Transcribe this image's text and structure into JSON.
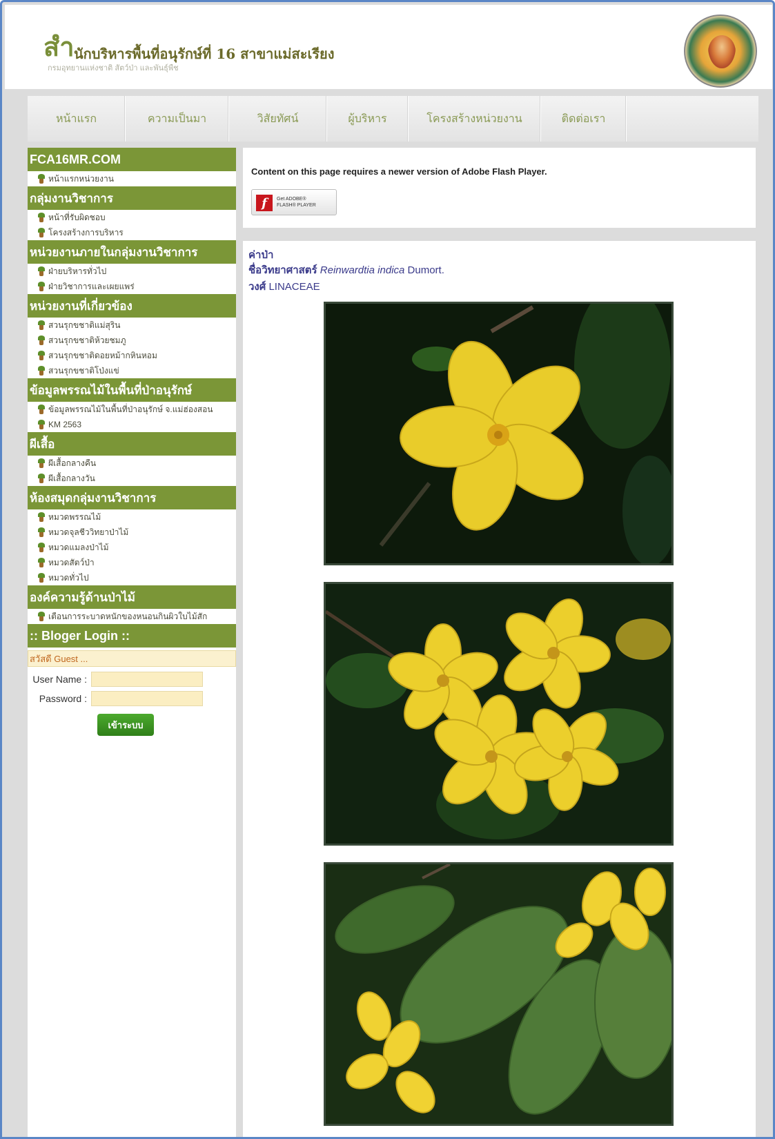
{
  "header": {
    "brand_char": "สำ",
    "title": "นักบริหารพื้นที่อนุรักษ์ที่ 16 สาขาแม่สะเรียง",
    "subtitle": "กรมอุทยานแห่งชาติ สัตว์ป่า และพันธุ์พืช"
  },
  "nav": [
    "หน้าแรก",
    "ความเป็นมา",
    "วิสัยทัศน์",
    "ผู้บริหาร",
    "โครงสร้างหน่วยงาน",
    "ติดต่อเรา"
  ],
  "sidebar": {
    "sections": [
      {
        "title": "FCA16MR.COM",
        "items": [
          "หน้าแรกหน่วยงาน"
        ]
      },
      {
        "title": "กลุ่มงานวิชาการ",
        "items": [
          "หน้าที่รับผิดชอบ",
          "โครงสร้างการบริหาร"
        ]
      },
      {
        "title": "หน่วยงานภายในกลุ่มงานวิชาการ",
        "items": [
          "ฝ่ายบริหารทั่วไป",
          "ฝ่ายวิชาการและเผยแพร่"
        ]
      },
      {
        "title": "หน่วยงานที่เกี่ยวข้อง",
        "items": [
          "สวนรุกขชาติแม่สุริน",
          "สวนรุกขชาติห้วยชมภู",
          "สวนรุกขชาติดอยหม้ากหินหอม",
          "สวนรุกขชาติโป่งแข่"
        ]
      },
      {
        "title": "ข้อมูลพรรณไม้ในพื้นที่ป่าอนุรักษ์",
        "items": [
          "ข้อมูลพรรณไม้ในพื้นที่ป่าอนุรักษ์ จ.แม่ฮ่องสอน",
          "KM 2563"
        ]
      },
      {
        "title": "ผีเสื้อ",
        "items": [
          "ผีเสื้อกลางคืน",
          "ผีเสื้อกลางวัน"
        ]
      },
      {
        "title": "ห้องสมุดกลุ่มงานวิชาการ",
        "items": [
          "หมวดพรรณไม้",
          "หมวดจุลชีววิทยาป่าไม้",
          "หมวดแมลงป่าไม้",
          "หมวดสัตว์ป่า",
          "หมวดทั่วไป"
        ]
      },
      {
        "title": "องค์ความรู้ด้านป่าไม้",
        "items": [
          "เตือนการระบาดหนักของหนอนกินผิวใบไม้สัก"
        ]
      }
    ],
    "login": {
      "title": ":: Bloger Login ::",
      "greeting": "สวัสดี Guest ...",
      "username_label": "User Name :",
      "password_label": "Password :",
      "button": "เข้าระบบ"
    }
  },
  "flash": {
    "message": "Content on this page requires a newer version of Adobe Flash Player.",
    "badge_line1": "Get ADOBE®",
    "badge_line2": "FLASH® PLAYER"
  },
  "plant": {
    "common_name": "ค่าป่า",
    "sci_label": "ชื่อวิทยาศาสตร์",
    "sci_genus": "Reinwardtia",
    "sci_species": "indica",
    "sci_author": "Dumort.",
    "family_label": "วงศ์",
    "family": "LINACEAE"
  },
  "colors": {
    "section_green": "#7b9637",
    "frame_blue": "#5a86c6",
    "flower_yellow": "#f2d02a"
  }
}
